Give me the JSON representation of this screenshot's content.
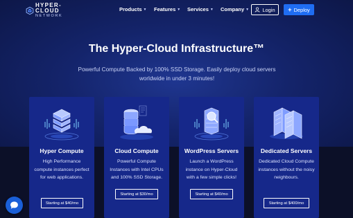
{
  "brand": {
    "name_top": "HYPER-CLOUD",
    "name_bottom": "NETWORK",
    "logo_icon": "hexagon-cube-icon"
  },
  "nav": {
    "items": [
      {
        "label": "Products",
        "icon": "chevron-down-icon"
      },
      {
        "label": "Features",
        "icon": "chevron-down-icon"
      },
      {
        "label": "Services",
        "icon": "chevron-down-icon"
      },
      {
        "label": "Company",
        "icon": "chevron-down-icon"
      }
    ],
    "login": {
      "label": "Login",
      "icon": "user-icon"
    },
    "deploy": {
      "label": "Deploy",
      "icon": "plus-icon"
    }
  },
  "hero": {
    "title": "The Hyper-Cloud Infrastructure™",
    "subtitle": "Powerful Compute Backed by 100% SSD Storage. Easily deploy cloud servers worldwide in under 3 minutes!"
  },
  "cards": [
    {
      "title": "Hyper Compute",
      "desc": "High Performance compute instances perfect for web applications.",
      "button": "Starting at $40/mo",
      "icon": "server-stack-icon"
    },
    {
      "title": "Cloud Compute",
      "desc": "Powerful Compute Instances with Intel CPUs and 100% SSD Storage.",
      "button": "Starting at $30/mo",
      "icon": "database-cloud-icon"
    },
    {
      "title": "WordPress Servers",
      "desc": "Launch a WordPress instance on Hyper-Cloud with a few simple clicks!",
      "button": "Starting at $40/mo",
      "icon": "server-search-icon"
    },
    {
      "title": "Dedicated Servers",
      "desc": "Dedicated Cloud Compute instances without the noisy neighbours.",
      "button": "Starting at $400/mo",
      "icon": "server-rack-icon"
    }
  ],
  "chat": {
    "icon": "chat-bubble-icon"
  },
  "colors": {
    "accent": "#1f6df2",
    "card_bg": "#16288a",
    "hero_bg": "#14246b",
    "page_bg": "#0b1026"
  }
}
